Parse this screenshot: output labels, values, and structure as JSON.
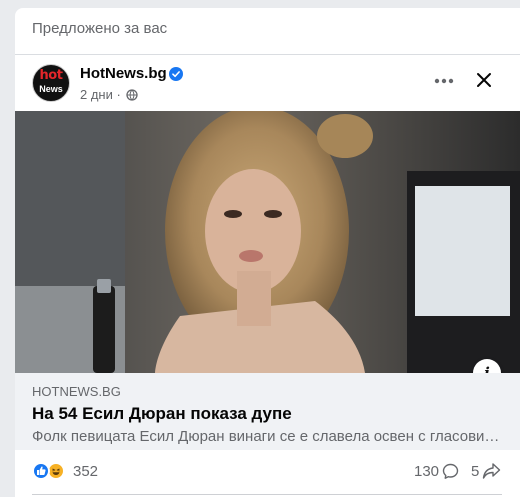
{
  "feed": {
    "suggested_label": "Предложено за вас"
  },
  "post": {
    "page_name": "HotNews.bg",
    "verified": true,
    "timestamp": "2 дни",
    "separator": "·",
    "audience_icon": "globe-icon",
    "avatar": {
      "line1": "hot",
      "line2": "News"
    },
    "actions": {
      "more_icon": "more-horizontal-icon",
      "close_icon": "close-icon"
    }
  },
  "media": {
    "info_label": "i"
  },
  "link_preview": {
    "domain": "HOTNEWS.BG",
    "headline": "На 54 Есил Дюран показа дупе",
    "description": "Фолк певицата Есил Дюран винаги се е славела освен с гласови…"
  },
  "stats": {
    "reactions": [
      "like-icon",
      "haha-icon"
    ],
    "reaction_count": "352",
    "comment_count": "130",
    "share_count": "5"
  },
  "colors": {
    "accent": "#1877f2",
    "secondary_text": "#65676b",
    "link_bg": "#f0f2f5"
  }
}
